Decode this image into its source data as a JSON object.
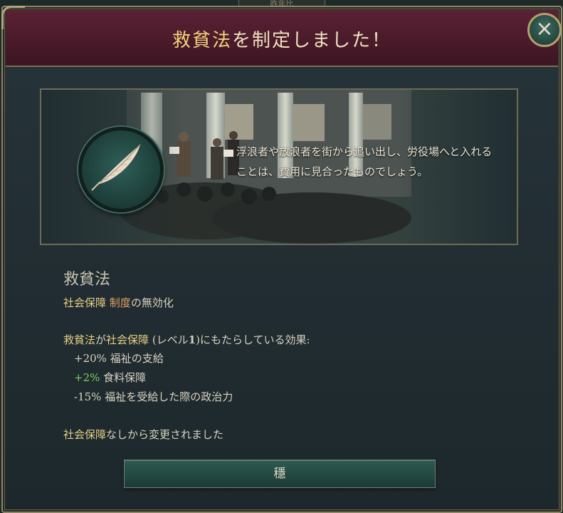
{
  "background_tab": "昨年比",
  "dialog": {
    "title_law": "救貧法",
    "title_rest": "を制定しました！",
    "close_glyph": "×"
  },
  "illustration": {
    "quote": "浮浪者や放浪者を街から追い出し、労役場へと入れることは、費用に見合ったものでしょう。",
    "emblem_icon": "feather-icon"
  },
  "law": {
    "name": "救貧法",
    "disables_group": "社会保障",
    "disables_word": "制度",
    "disables_suffix": "の無効化",
    "effects_intro_law": "救貧法",
    "effects_intro_mid": "が",
    "effects_intro_group": "社会保障",
    "effects_intro_level_pre": " (レベル",
    "effects_intro_level": "1",
    "effects_intro_level_post": ")にもたらしている効果:",
    "effects": [
      {
        "value": "+20%",
        "label": " 福祉の支給"
      },
      {
        "value": "+2%",
        "label": " 食料保障"
      },
      {
        "value": "-15%",
        "label": " 福祉を受給した際の政治力"
      }
    ],
    "changed_group": "社会保障",
    "changed_text": "なしから変更されました"
  },
  "confirm_button": "穩",
  "colors": {
    "title_bar": "#4a1a2a",
    "gold": "#e6cf86",
    "orange": "#e0a165",
    "green": "#7fcf5c",
    "button": "#244a44"
  }
}
